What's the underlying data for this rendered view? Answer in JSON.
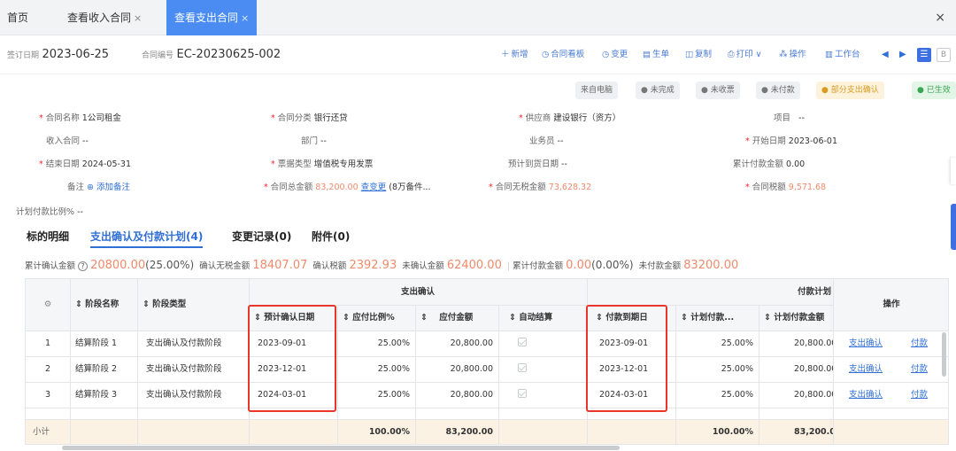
{
  "tabs": [
    {
      "label": "首页"
    },
    {
      "label": "查看收入合同",
      "close": "×"
    },
    {
      "label": "查看支出合同",
      "close": "×"
    }
  ],
  "window_close": "×",
  "toolbar": {
    "sign_date_label": "签订日期",
    "sign_date": "2023-06-25",
    "contract_no_label": "合同编号",
    "contract_no": "EC-20230625-002",
    "actions": [
      {
        "label": "新增",
        "icon": "＋"
      },
      {
        "label": "合同看板",
        "icon": "◷"
      },
      {
        "label": "变更",
        "icon": "◷"
      },
      {
        "label": "生单",
        "icon": "▤"
      },
      {
        "label": "复制",
        "icon": "◫"
      },
      {
        "label": "打印",
        "icon": "⎙"
      },
      {
        "label": "操作",
        "icon": "⁂"
      },
      {
        "label": "工作台",
        "icon": "▥"
      }
    ],
    "print_arrow": "∨",
    "nav_prev": "◀",
    "nav_next": "▶",
    "list_view": "☰",
    "grid_view": "B"
  },
  "status": {
    "source": "来自电脑",
    "items": [
      {
        "label": "未完成",
        "icon": "●"
      },
      {
        "label": "未收票",
        "icon": "●"
      },
      {
        "label": "未付款",
        "icon": "●"
      },
      {
        "label": "部分支出确认",
        "icon": "●"
      },
      {
        "label": "已生效",
        "icon": "●"
      }
    ]
  },
  "form": {
    "contract_name_label": "合同名称",
    "contract_name": "1公司租金",
    "category_label": "合同分类",
    "category": "银行还贷",
    "supplier_label": "供应商",
    "supplier": "建设银行（资方）",
    "project_label": "项目",
    "project": "--",
    "income_contract_label": "收入合同",
    "income_contract": "--",
    "dept_label": "部门",
    "dept": "--",
    "salesman_label": "业务员",
    "salesman": "--",
    "start_date_label": "开始日期",
    "start_date": "2023-06-01",
    "end_date_label": "结束日期",
    "end_date": "2024-05-31",
    "invoice_type_label": "票据类型",
    "invoice_type": "增值税专用发票",
    "arrival_date_label": "预计到货日期",
    "arrival_date": "--",
    "paid_total_label": "累计付款金额",
    "paid_total": "0.00",
    "note_label": "备注",
    "note_link": "添加备注",
    "note_icon": "⊕",
    "total_label": "合同总金额",
    "total": "83,200.00",
    "change_link": "查变更",
    "total_extra": "(8万备件...",
    "notax_label": "合同无税金额",
    "notax": "73,628.32",
    "tax_label": "合同税额",
    "tax": "9,571.68",
    "plan_ratio_label": "计划付款比例%",
    "plan_ratio": "--"
  },
  "section_tabs": [
    {
      "label": "标的明细"
    },
    {
      "label": "支出确认及付款计划(4)"
    },
    {
      "label": "变更记录(0)"
    },
    {
      "label": "附件(0)"
    }
  ],
  "summary": {
    "confirm_label": "累计确认金额",
    "help_icon": "?",
    "confirm_amount": "20800.00",
    "confirm_pct": "(25.00%)",
    "confirm_notax_label": "确认无税金额",
    "confirm_notax": "18407.07",
    "confirm_tax_label": "确认税额",
    "confirm_tax": "2392.93",
    "unconfirmed_label": "未确认金额",
    "unconfirmed": "62400.00",
    "paid_label": "累计付款金额",
    "paid": "0.00",
    "paid_pct": "(0.00%)",
    "unpaid_label": "未付款金额",
    "unpaid": "83200.00"
  },
  "table": {
    "settings_icon": "⚙",
    "group_confirm": "支出确认",
    "group_pay": "付款计划",
    "op_header": "操作",
    "headers": [
      "阶段名称",
      "阶段类型",
      "预计确认日期",
      "应付比例%",
      "应付金额",
      "自动结算",
      "付款到期日",
      "计划付款...",
      "计划付款金额"
    ],
    "sort_icon": "⇕",
    "rows": [
      {
        "idx": "1",
        "name": "结算阶段 1",
        "type": "支出确认及付款阶段",
        "confirm_date": "2023-09-01",
        "ratio": "25.00%",
        "amount": "20,800.00",
        "due": "2023-09-01",
        "plan_ratio": "25.00%",
        "plan_amount": "20,800.00",
        "op1": "支出确认",
        "op2": "付款"
      },
      {
        "idx": "2",
        "name": "结算阶段 2",
        "type": "支出确认及付款阶段",
        "confirm_date": "2023-12-01",
        "ratio": "25.00%",
        "amount": "20,800.00",
        "due": "2023-12-01",
        "plan_ratio": "25.00%",
        "plan_amount": "20,800.00",
        "op1": "支出确认",
        "op2": "付款"
      },
      {
        "idx": "3",
        "name": "结算阶段 3",
        "type": "支出确认及付款阶段",
        "confirm_date": "2024-03-01",
        "ratio": "25.00%",
        "amount": "20,800.00",
        "due": "2024-03-01",
        "plan_ratio": "25.00%",
        "plan_amount": "20,800.00",
        "op1": "支出确认",
        "op2": "付款"
      }
    ],
    "subtotal_label": "小计",
    "subtotal_ratio": "100.00%",
    "subtotal_amount": "83,200.00",
    "subtotal_plan_ratio": "100.00%",
    "subtotal_plan_amount": "83,200.00"
  },
  "colors": {
    "accent": "#2f6fd6",
    "tab_active": "#4a8cf2",
    "highlight_box": "#e8362d",
    "orange_value": "#f08a6b",
    "subtotal_bg": "#fbf2e3"
  }
}
